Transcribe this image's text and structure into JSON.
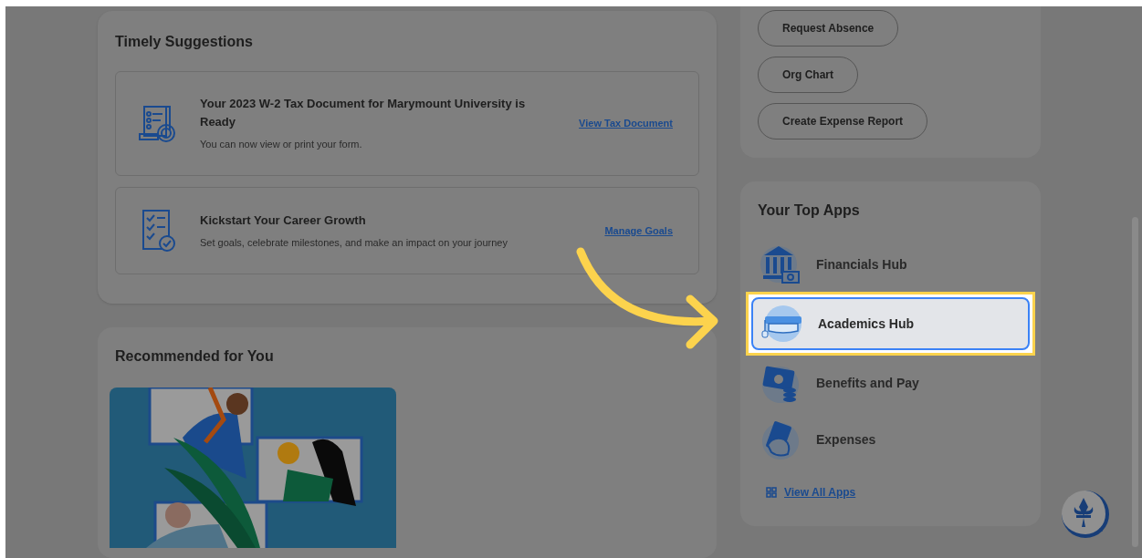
{
  "timely_suggestions": {
    "title": "Timely Suggestions",
    "items": [
      {
        "title": "Your 2023 W-2 Tax Document for Marymount University is Ready",
        "description": "You can now view or print your form.",
        "link": "View Tax Document"
      },
      {
        "title": "Kickstart Your Career Growth",
        "description": "Set goals, celebrate milestones, and make an impact on your journey",
        "link": "Manage Goals"
      }
    ]
  },
  "recommended": {
    "title": "Recommended for You"
  },
  "quick_actions": [
    "Request Absence",
    "Org Chart",
    "Create Expense Report"
  ],
  "top_apps": {
    "title": "Your Top Apps",
    "items": [
      {
        "label": "Financials Hub",
        "selected": false
      },
      {
        "label": "Academics Hub",
        "selected": true
      },
      {
        "label": "Benefits and Pay",
        "selected": false
      },
      {
        "label": "Expenses",
        "selected": false
      }
    ],
    "view_all": "View All Apps"
  }
}
